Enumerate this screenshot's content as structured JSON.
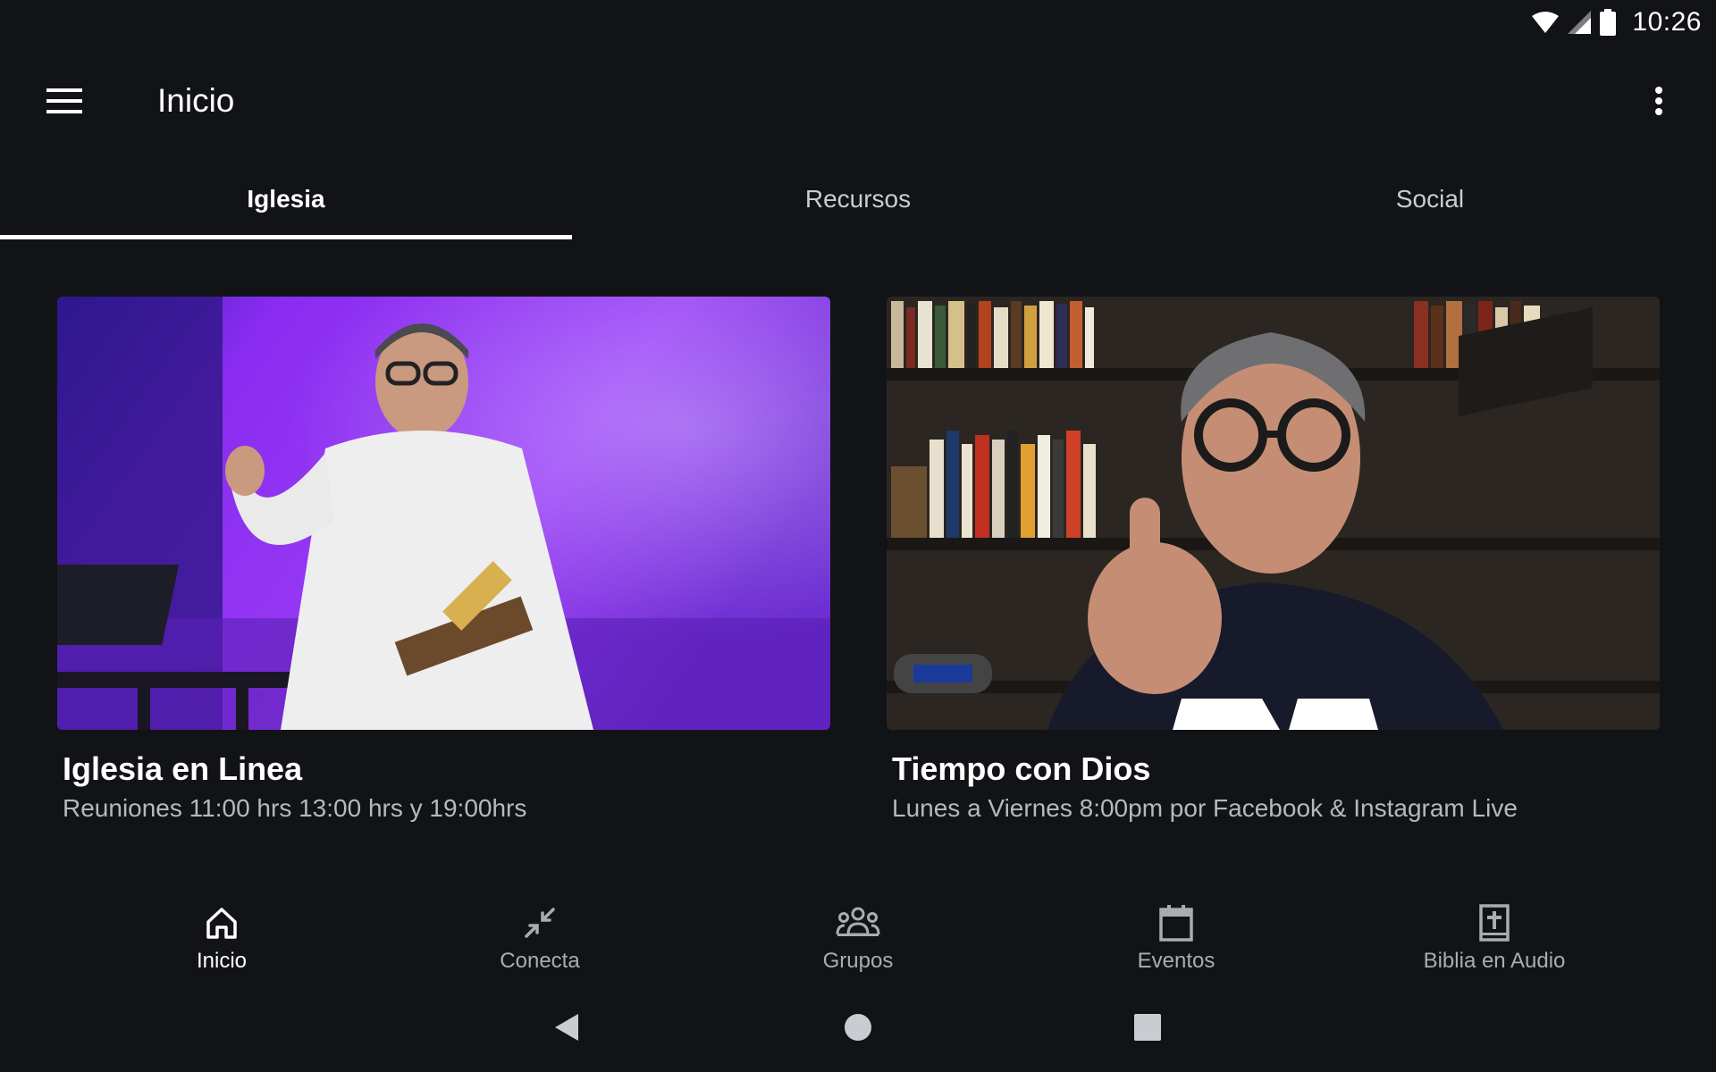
{
  "status_bar": {
    "time": "10:26"
  },
  "app_bar": {
    "title": "Inicio"
  },
  "tabs": [
    {
      "label": "Iglesia",
      "active": true
    },
    {
      "label": "Recursos",
      "active": false
    },
    {
      "label": "Social",
      "active": false
    }
  ],
  "cards": [
    {
      "title": "Iglesia en Linea",
      "subtitle": "Reuniones 11:00 hrs 13:00 hrs y 19:00hrs"
    },
    {
      "title": "Tiempo con Dios",
      "subtitle": "Lunes a Viernes 8:00pm por Facebook & Instagram Live"
    }
  ],
  "bottom_nav": [
    {
      "label": "Inicio",
      "icon": "home-icon",
      "active": true
    },
    {
      "label": "Conecta",
      "icon": "collapse-arrows-icon",
      "active": false
    },
    {
      "label": "Grupos",
      "icon": "groups-icon",
      "active": false
    },
    {
      "label": "Eventos",
      "icon": "calendar-icon",
      "active": false
    },
    {
      "label": "Biblia en Audio",
      "icon": "bible-icon",
      "active": false
    }
  ],
  "colors": {
    "background": "#111317",
    "accent": "#ffffff",
    "inactive_text": "#a9adb2"
  }
}
